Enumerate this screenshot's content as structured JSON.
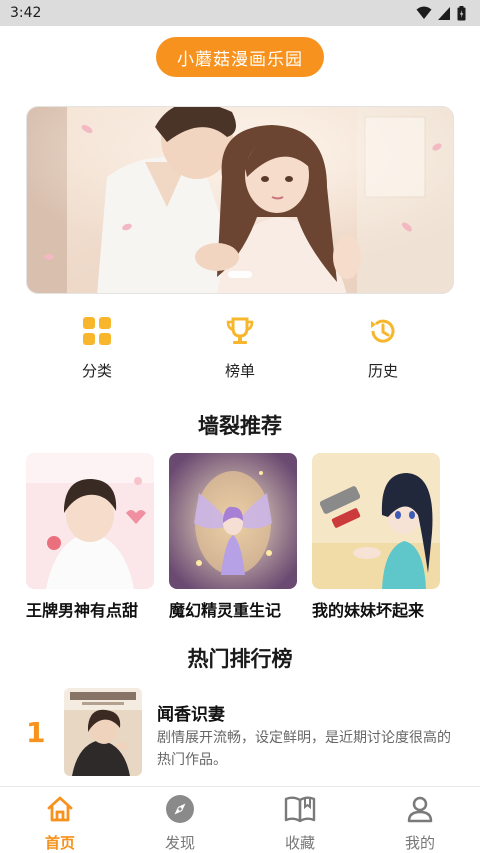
{
  "status": {
    "time": "3:42"
  },
  "header": {
    "title": "小蘑菇漫画乐园"
  },
  "quick_actions": [
    {
      "label": "分类",
      "icon": "grid-icon"
    },
    {
      "label": "榜单",
      "icon": "trophy-icon"
    },
    {
      "label": "历史",
      "icon": "history-icon"
    }
  ],
  "recommend": {
    "title": "墙裂推荐",
    "items": [
      {
        "title": "王牌男神有点甜"
      },
      {
        "title": "魔幻精灵重生记"
      },
      {
        "title": "我的妹妹坏起来"
      }
    ]
  },
  "ranking": {
    "title": "热门排行榜",
    "items": [
      {
        "rank": "1",
        "title": "闻香识妻",
        "desc": "剧情展开流畅，设定鲜明，是近期讨论度很高的热门作品。"
      }
    ]
  },
  "bottom_nav": [
    {
      "label": "首页",
      "icon": "home-icon",
      "active": true
    },
    {
      "label": "发现",
      "icon": "compass-icon",
      "active": false
    },
    {
      "label": "收藏",
      "icon": "book-icon",
      "active": false
    },
    {
      "label": "我的",
      "icon": "user-icon",
      "active": false
    }
  ],
  "colors": {
    "accent": "#f7921e",
    "status_bar": "#dcdcdc",
    "nav_inactive": "#777777"
  }
}
